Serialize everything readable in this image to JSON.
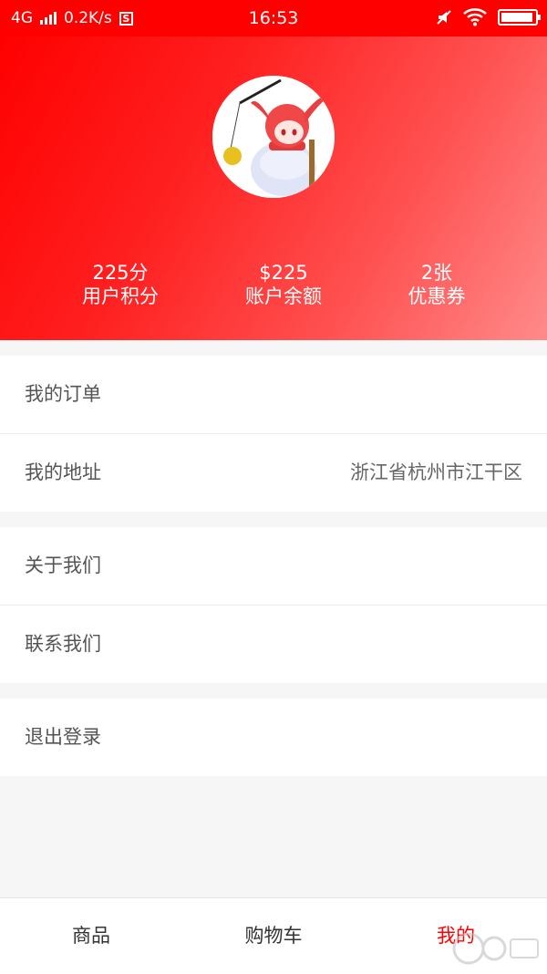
{
  "status_bar": {
    "network": "4G",
    "speed": "0.2K/s",
    "time": "16:53",
    "battery_level": 0.95
  },
  "profile": {
    "avatar_icon": "anime-avatar-icon"
  },
  "stats": [
    {
      "value": "225分",
      "label": "用户积分"
    },
    {
      "value": "$225",
      "label": "账户余额"
    },
    {
      "value": "2张",
      "label": "优惠券"
    }
  ],
  "menu": {
    "group1": [
      {
        "label": "我的订单",
        "value": ""
      },
      {
        "label": "我的地址",
        "value": "浙江省杭州市江干区"
      }
    ],
    "group2": [
      {
        "label": "关于我们"
      },
      {
        "label": "联系我们"
      }
    ],
    "group3": [
      {
        "label": "退出登录"
      }
    ]
  },
  "tabbar": {
    "items": [
      {
        "label": "商品"
      },
      {
        "label": "购物车"
      },
      {
        "label": "我的"
      }
    ],
    "active_index": 2,
    "active_color": "#ff0000"
  },
  "colors": {
    "header_start": "#ff0000",
    "header_end": "#ff8a8a"
  }
}
